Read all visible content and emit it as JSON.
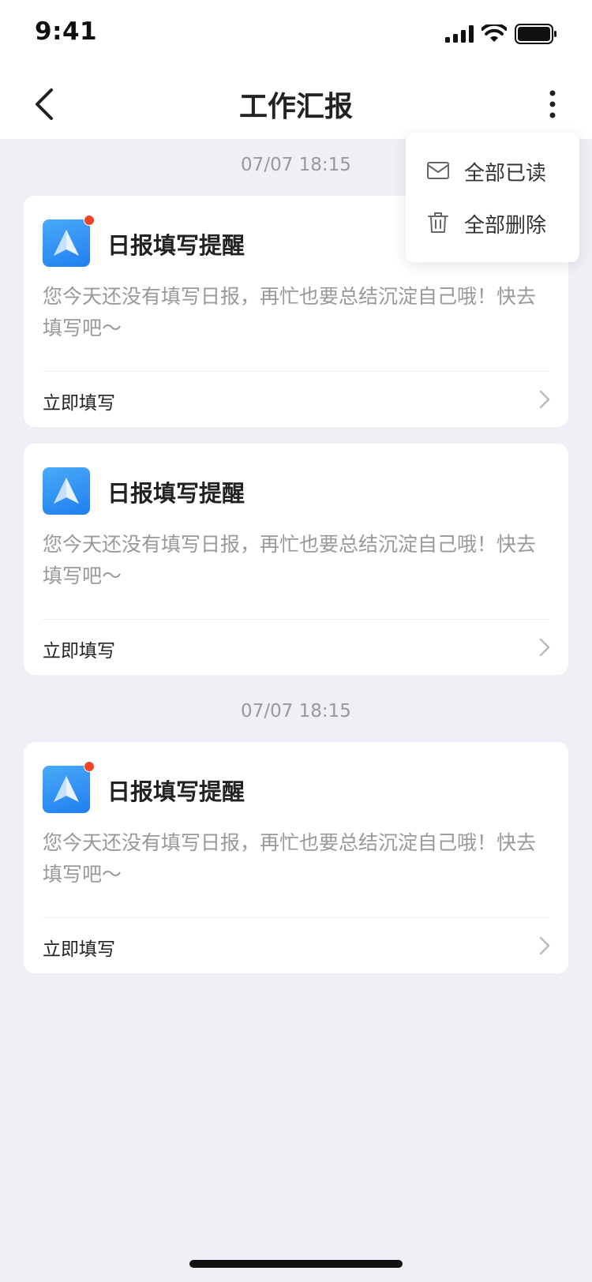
{
  "status_bar": {
    "time": "9:41"
  },
  "nav": {
    "title": "工作汇报"
  },
  "menu": {
    "items": [
      {
        "label": "全部已读",
        "icon": "mail-icon"
      },
      {
        "label": "全部删除",
        "icon": "trash-icon"
      }
    ]
  },
  "messages": {
    "groups": [
      {
        "time": "07/07 18:15",
        "cards": [
          {
            "title": "日报填写提醒",
            "body": "您今天还没有填写日报，再忙也要总结沉淀自己哦！快去填写吧～",
            "action": "立即填写",
            "unread": true
          },
          {
            "title": "日报填写提醒",
            "body": "您今天还没有填写日报，再忙也要总结沉淀自己哦！快去填写吧～",
            "action": "立即填写",
            "unread": false
          }
        ]
      },
      {
        "time": "07/07 18:15",
        "cards": [
          {
            "title": "日报填写提醒",
            "body": "您今天还没有填写日报，再忙也要总结沉淀自己哦！快去填写吧～",
            "action": "立即填写",
            "unread": true
          }
        ]
      }
    ]
  },
  "colors": {
    "background": "#eef0f5",
    "accent_blue": "#1f7ff0",
    "unread_red": "#f0432c"
  }
}
